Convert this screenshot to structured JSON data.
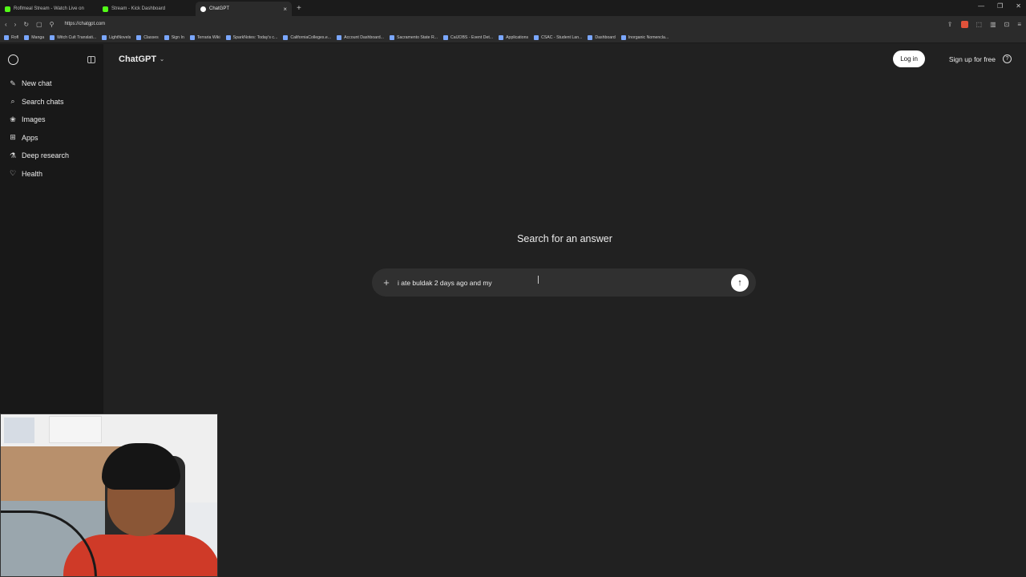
{
  "browser": {
    "tabs": [
      {
        "title": "Roflmeal Stream - Watch Live on"
      },
      {
        "title": "Stream - Kick Dashboard"
      },
      {
        "title": "ChatGPT",
        "active": true
      }
    ],
    "url": "https://chatgpt.com",
    "bookmarks": [
      "Rofl",
      "Manga",
      "Witch Cult Translati...",
      "LightNovels",
      "Classes",
      "Sign In",
      "Terraria Wiki",
      "SparkNotes: Today's c...",
      "CaliforniaColleges.e...",
      "Account Dashboard...",
      "Sacramento State R...",
      "CalJOBS - Event Det...",
      "Applications",
      "CSAC - Student Lan...",
      "Dashboard",
      "Inorganic Nomencla..."
    ]
  },
  "sidebar": {
    "items": [
      {
        "label": "New chat",
        "icon": "new-chat-icon"
      },
      {
        "label": "Search chats",
        "icon": "search-icon"
      },
      {
        "label": "Images",
        "icon": "images-icon"
      },
      {
        "label": "Apps",
        "icon": "apps-icon"
      },
      {
        "label": "Deep research",
        "icon": "deep-research-icon"
      },
      {
        "label": "Health",
        "icon": "heart-icon"
      }
    ]
  },
  "header": {
    "model": "ChatGPT",
    "login": "Log in",
    "signup": "Sign up for free"
  },
  "main": {
    "heading": "Search for an answer",
    "composer_value": "i ate buldak 2 days ago and my"
  },
  "colors": {
    "background": "#212121",
    "sidebar": "#181818",
    "composer": "#303030",
    "text": "#ececec"
  }
}
